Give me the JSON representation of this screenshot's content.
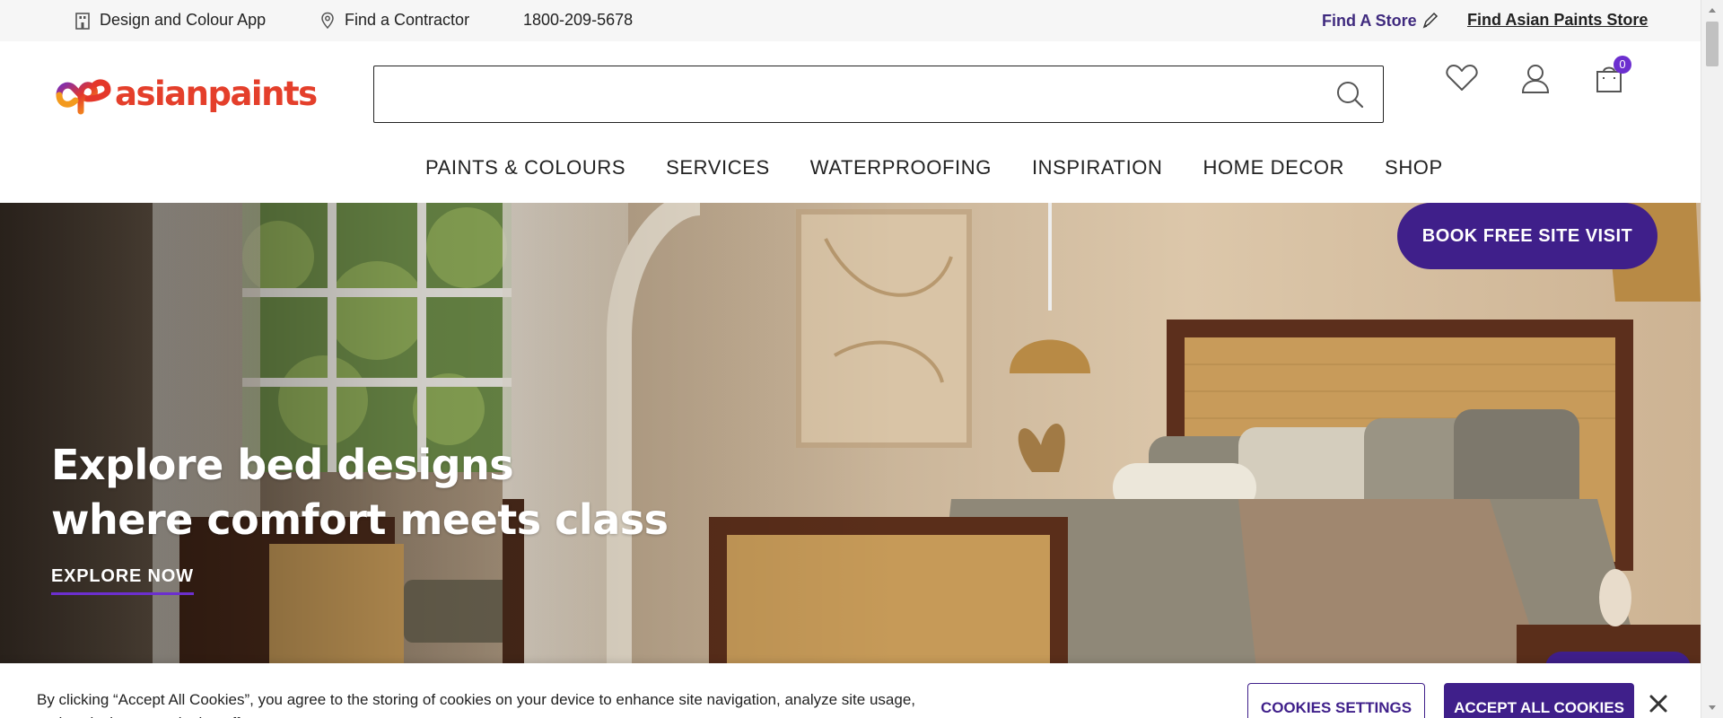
{
  "topbar": {
    "design_app": "Design and Colour App",
    "contractor": "Find a Contractor",
    "phone": "1800-209-5678",
    "find_store": "Find A Store",
    "find_ap_store": "Find Asian Paints Store"
  },
  "header": {
    "logo_text": "asianpaints",
    "search_placeholder": "",
    "cart_count": "0",
    "icons": [
      "search-icon",
      "heart-icon",
      "user-icon",
      "cart-icon"
    ]
  },
  "nav": {
    "items": [
      "PAINTS & COLOURS",
      "SERVICES",
      "WATERPROOFING",
      "INSPIRATION",
      "HOME DECOR",
      "SHOP"
    ]
  },
  "hero": {
    "title_line1": "Explore bed designs",
    "title_line2": "where comfort meets class",
    "cta": "EXPLORE NOW",
    "visit_button": "BOOK FREE SITE VISIT"
  },
  "cookie": {
    "message": "By clicking “Accept All Cookies”, you agree to the storing of cookies on your device to enhance site navigation, analyze site usage, and assist in our marketing efforts.",
    "settings_button": "COOKIES SETTINGS",
    "accept_button": "ACCEPT ALL COOKIES"
  },
  "colors": {
    "brand_purple": "#3f1f8a",
    "accent_violet": "#6c2fcf",
    "logo_red": "#e43f2b"
  }
}
